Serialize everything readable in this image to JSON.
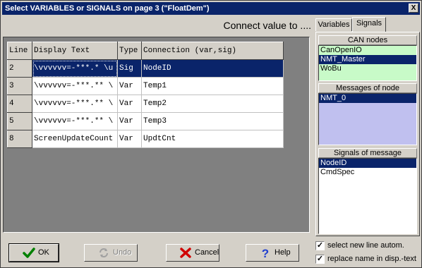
{
  "window": {
    "title": "Select VARIABLES or SIGNALS on page 3 (\"FloatDem\")",
    "close_glyph": "X"
  },
  "connect_label": "Connect value to ....",
  "grid": {
    "headers": [
      "Line",
      "Display Text",
      "Type",
      "Connection (var,sig)"
    ],
    "rows": [
      {
        "line": "2",
        "display": "\\vvvvvv=-***.* \\u",
        "type": "Sig",
        "connection": "NodeID",
        "selected": true
      },
      {
        "line": "3",
        "display": "\\vvvvvv=-***.** \\",
        "type": "Var",
        "connection": "Temp1",
        "selected": false
      },
      {
        "line": "4",
        "display": "\\vvvvvv=-***.** \\",
        "type": "Var",
        "connection": "Temp2",
        "selected": false
      },
      {
        "line": "5",
        "display": "\\vvvvvv=-***.** \\",
        "type": "Var",
        "connection": "Temp3",
        "selected": false
      },
      {
        "line": "8",
        "display": "ScreenUpdateCount",
        "type": "Var",
        "connection": "UpdtCnt",
        "selected": false
      }
    ]
  },
  "tabs": [
    {
      "label": "Variables",
      "active": false
    },
    {
      "label": "Signals",
      "active": true
    }
  ],
  "can_nodes": {
    "header": "CAN nodes",
    "items": [
      "CanOpenIO",
      "NMT_Master",
      "WoBu"
    ],
    "selected_index": 1
  },
  "messages": {
    "header": "Messages of node",
    "items": [
      "NMT_0"
    ],
    "selected_index": 0
  },
  "signals": {
    "header": "Signals of message",
    "items": [
      "NodeID",
      "CmdSpec"
    ],
    "selected_index": 0
  },
  "options": {
    "select_new_line": {
      "label": "select new line autom.",
      "checked": true
    },
    "replace_name": {
      "label": "replace name in disp.-text",
      "checked": true
    }
  },
  "buttons": {
    "ok": "OK",
    "undo": "Undo",
    "cancel": "Cancel",
    "help": "Help"
  },
  "icons": {
    "ok": "checkmark-icon",
    "undo": "undo-arrows-icon",
    "cancel": "red-x-icon",
    "help": "question-mark-icon"
  }
}
